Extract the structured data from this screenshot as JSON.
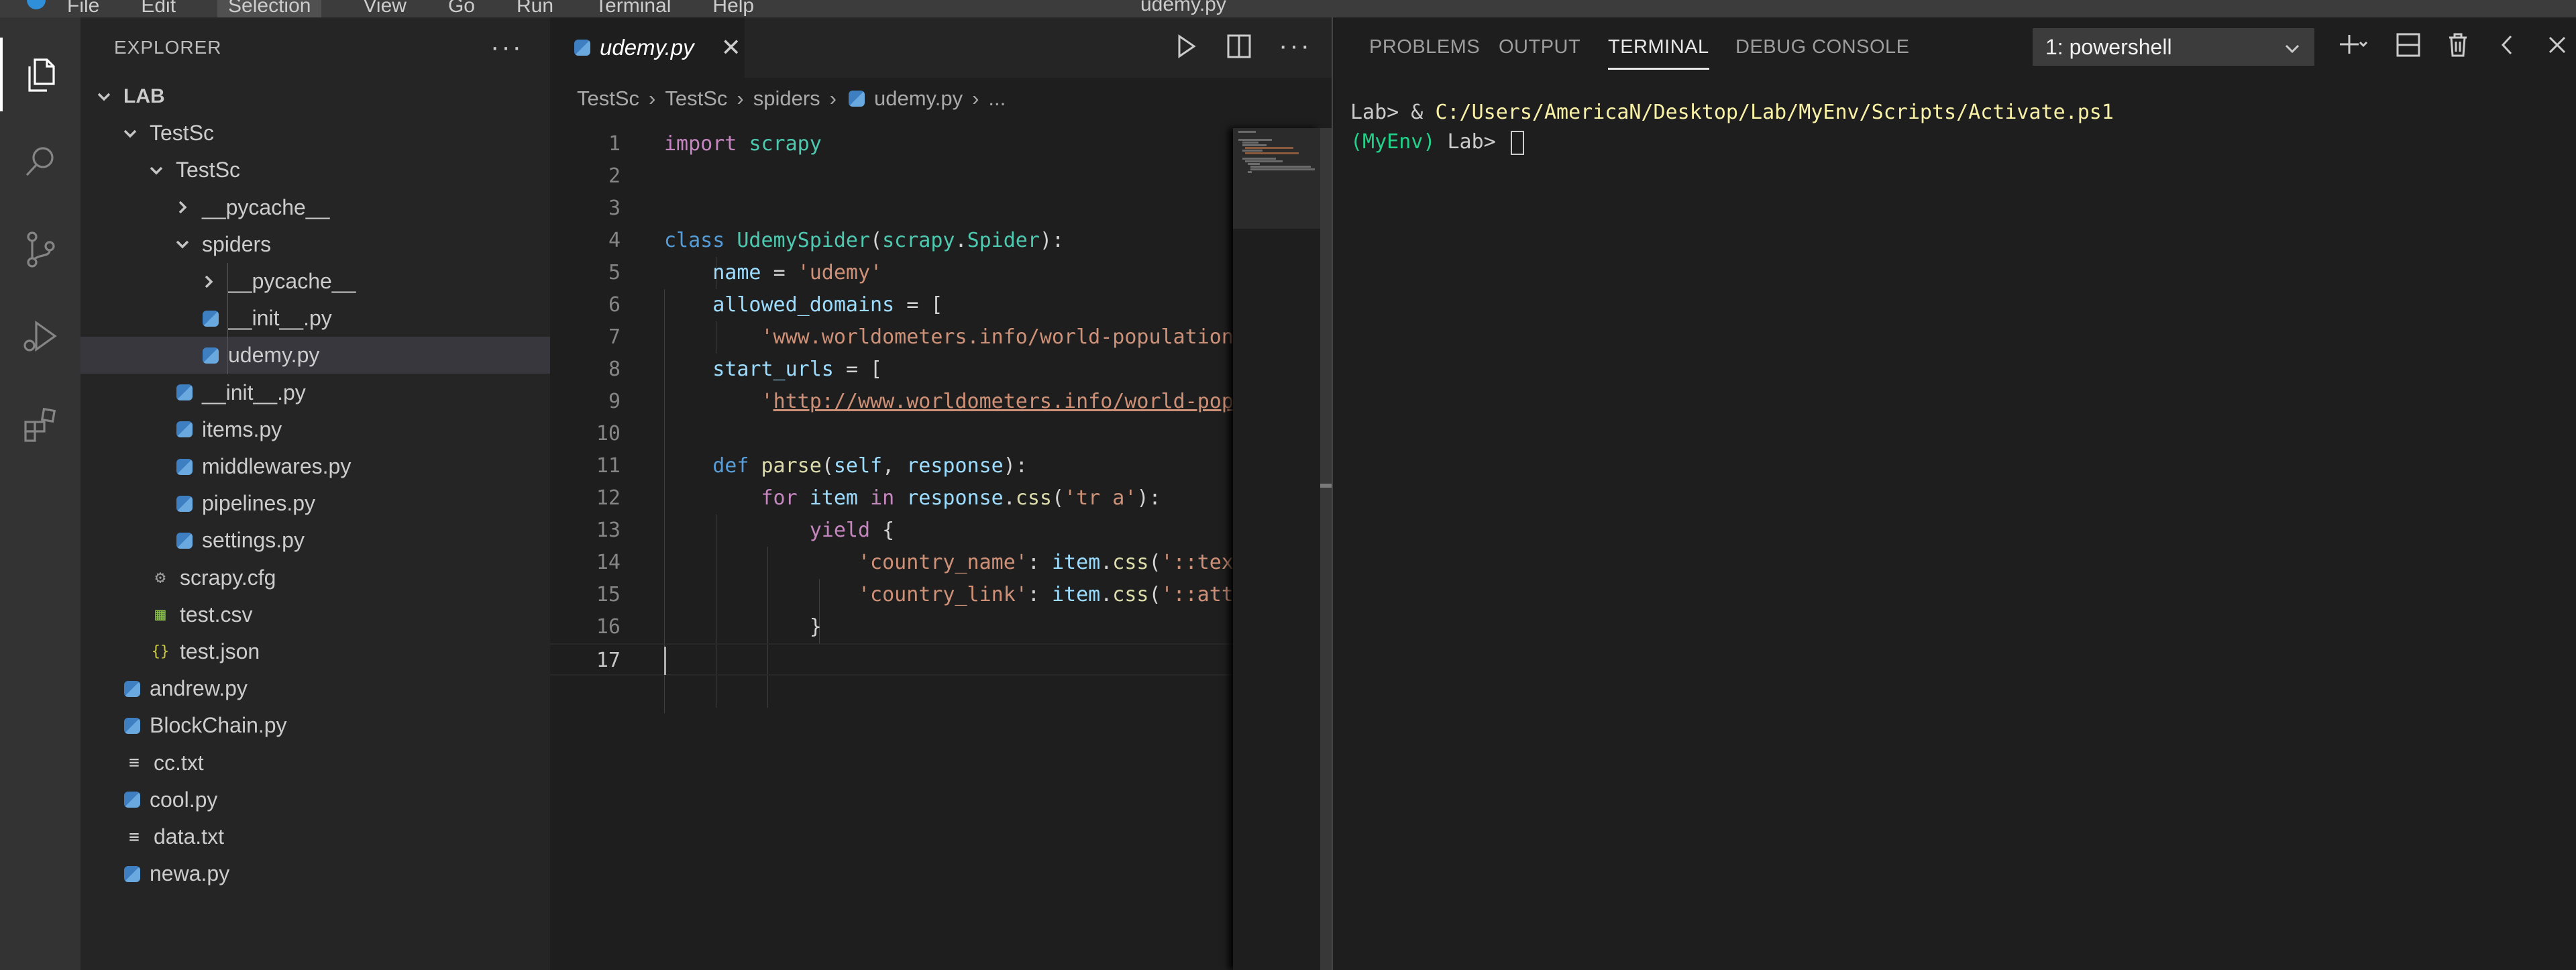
{
  "menubar": {
    "items": [
      "File",
      "Edit",
      "Selection",
      "View",
      "Go",
      "Run",
      "Terminal",
      "Help"
    ],
    "window_title": "udemy.py"
  },
  "activity_bar": {
    "items": [
      "files-icon",
      "search-icon",
      "source-control-icon",
      "run-debug-icon",
      "extensions-icon"
    ]
  },
  "sidebar": {
    "title": "EXPLORER",
    "more": "···",
    "tree": [
      {
        "label": "LAB",
        "type": "folder-open",
        "depth": 0,
        "bold": true
      },
      {
        "label": "TestSc",
        "type": "folder-open",
        "depth": 1
      },
      {
        "label": "TestSc",
        "type": "folder-open",
        "depth": 2
      },
      {
        "label": "__pycache__",
        "type": "folder-closed",
        "depth": 3
      },
      {
        "label": "spiders",
        "type": "folder-open",
        "depth": 3
      },
      {
        "label": "__pycache__",
        "type": "folder-closed",
        "depth": 4
      },
      {
        "label": "__init__.py",
        "type": "python",
        "depth": 4
      },
      {
        "label": "udemy.py",
        "type": "python",
        "depth": 4,
        "selected": true
      },
      {
        "label": "__init__.py",
        "type": "python",
        "depth": 3
      },
      {
        "label": "items.py",
        "type": "python",
        "depth": 3
      },
      {
        "label": "middlewares.py",
        "type": "python",
        "depth": 3
      },
      {
        "label": "pipelines.py",
        "type": "python",
        "depth": 3
      },
      {
        "label": "settings.py",
        "type": "python",
        "depth": 3
      },
      {
        "label": "scrapy.cfg",
        "type": "config",
        "depth": 2
      },
      {
        "label": "test.csv",
        "type": "csv",
        "depth": 2
      },
      {
        "label": "test.json",
        "type": "json",
        "depth": 2
      },
      {
        "label": "andrew.py",
        "type": "python",
        "depth": 1
      },
      {
        "label": "BlockChain.py",
        "type": "python",
        "depth": 1
      },
      {
        "label": "cc.txt",
        "type": "text",
        "depth": 1
      },
      {
        "label": "cool.py",
        "type": "python",
        "depth": 1
      },
      {
        "label": "data.txt",
        "type": "text",
        "depth": 1
      },
      {
        "label": "newa.py",
        "type": "python",
        "depth": 1
      }
    ]
  },
  "editor": {
    "tab_label": "udemy.py",
    "tab_close": "✕",
    "more_actions": "···",
    "breadcrumb": [
      "TestSc",
      "TestSc",
      "spiders",
      "udemy.py",
      "..."
    ],
    "line_numbers": [
      "1",
      "2",
      "3",
      "4",
      "5",
      "6",
      "7",
      "8",
      "9",
      "10",
      "11",
      "12",
      "13",
      "14",
      "15",
      "16",
      "17"
    ],
    "active_line": 17
  },
  "panel": {
    "tabs": [
      "PROBLEMS",
      "OUTPUT",
      "TERMINAL",
      "DEBUG CONSOLE"
    ],
    "active_tab": "TERMINAL",
    "terminal_select": "1: powershell",
    "terminal_lines": {
      "line1_prompt": "Lab> & ",
      "line1_path": "C:/Users/AmericaN/Desktop/Lab/MyEnv/Scripts/Activate.ps1",
      "line2_env": "(MyEnv)",
      "line2_prompt": " Lab> "
    }
  }
}
